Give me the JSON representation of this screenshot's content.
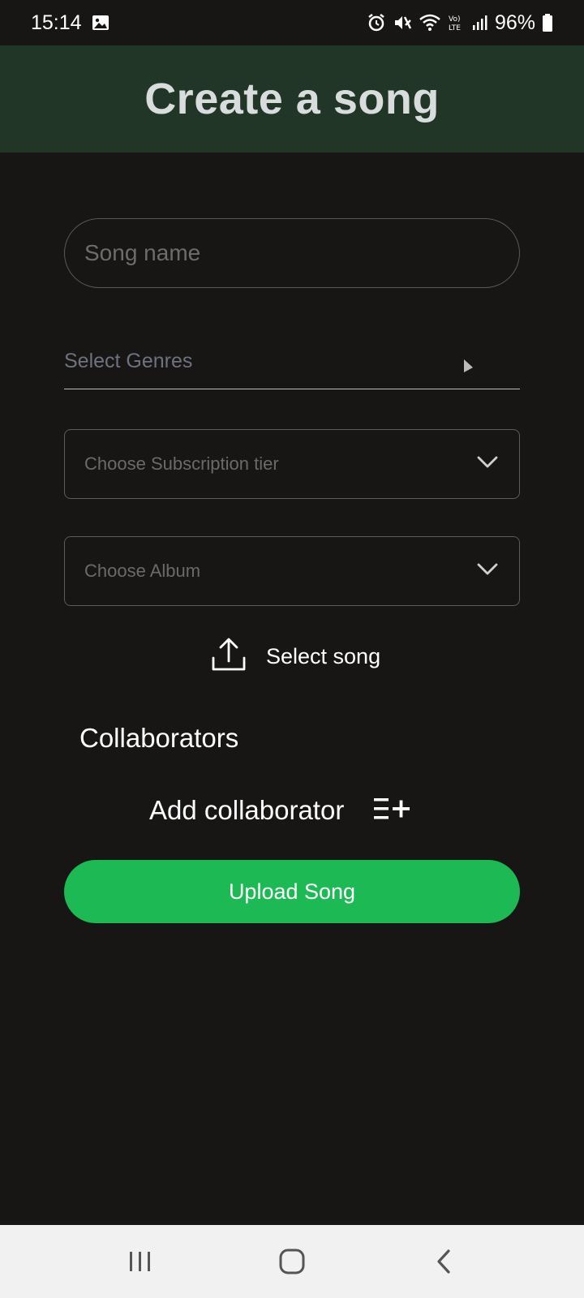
{
  "status_bar": {
    "time": "15:14",
    "battery": "96%",
    "icons": [
      "image-icon",
      "alarm-icon",
      "mute-icon",
      "wifi-icon",
      "volte-icon",
      "signal-icon",
      "battery-icon"
    ]
  },
  "header": {
    "title": "Create a song",
    "background": "#223628"
  },
  "form": {
    "song_name": {
      "value": "",
      "placeholder": "Song name"
    },
    "genres_label": "Select Genres",
    "subscription_tier_placeholder": "Choose Subscription tier",
    "album_placeholder": "Choose Album",
    "select_song_label": "Select song",
    "collaborators_title": "Collaborators",
    "add_collaborator_label": "Add collaborator",
    "upload_button_label": "Upload Song"
  },
  "colors": {
    "accent": "#1db954",
    "background": "#181515",
    "nav_background": "#f1f1f1"
  },
  "nav": {
    "items": [
      "recent-apps-icon",
      "home-icon",
      "back-icon"
    ]
  }
}
